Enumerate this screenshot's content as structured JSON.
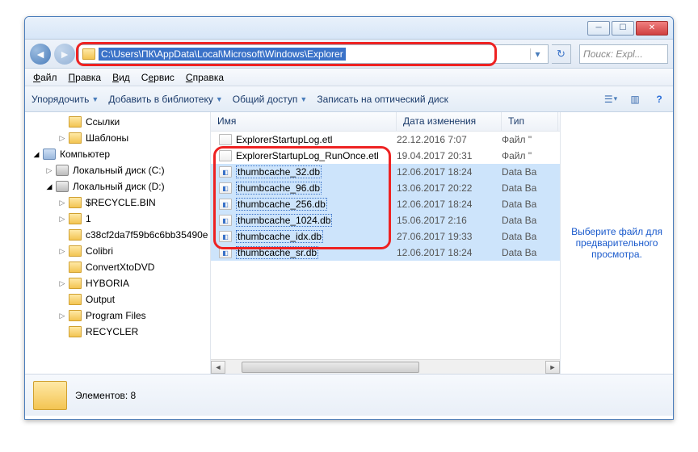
{
  "address_path": "C:\\Users\\ПК\\AppData\\Local\\Microsoft\\Windows\\Explorer",
  "search_placeholder": "Поиск: Expl...",
  "menu": {
    "file": "Файл",
    "edit": "Правка",
    "view": "Вид",
    "tools": "Сервис",
    "help": "Справка"
  },
  "toolbar": {
    "organize": "Упорядочить",
    "library": "Добавить в библиотеку",
    "share": "Общий доступ",
    "burn": "Записать на оптический диск"
  },
  "tree": [
    {
      "depth": 2,
      "arrow": "",
      "icon": "folder",
      "label": "Ссылки"
    },
    {
      "depth": 2,
      "arrow": "▷",
      "icon": "folder",
      "label": "Шаблоны"
    },
    {
      "depth": 0,
      "arrow": "◢",
      "icon": "comp",
      "label": "Компьютер"
    },
    {
      "depth": 1,
      "arrow": "▷",
      "icon": "drive",
      "label": "Локальный диск (C:)"
    },
    {
      "depth": 1,
      "arrow": "◢",
      "icon": "drive",
      "label": "Локальный диск (D:)"
    },
    {
      "depth": 2,
      "arrow": "▷",
      "icon": "folder",
      "label": "$RECYCLE.BIN"
    },
    {
      "depth": 2,
      "arrow": "▷",
      "icon": "folder",
      "label": "1"
    },
    {
      "depth": 2,
      "arrow": "",
      "icon": "folder",
      "label": "c38cf2da7f59b6c6bb35490e"
    },
    {
      "depth": 2,
      "arrow": "▷",
      "icon": "folder",
      "label": "Colibri"
    },
    {
      "depth": 2,
      "arrow": "",
      "icon": "folder",
      "label": "ConvertXtoDVD"
    },
    {
      "depth": 2,
      "arrow": "▷",
      "icon": "folder",
      "label": "HYBORIA"
    },
    {
      "depth": 2,
      "arrow": "",
      "icon": "folder",
      "label": "Output"
    },
    {
      "depth": 2,
      "arrow": "▷",
      "icon": "folder",
      "label": "Program Files"
    },
    {
      "depth": 2,
      "arrow": "",
      "icon": "folder",
      "label": "RECYCLER"
    }
  ],
  "columns": {
    "name": "Имя",
    "date": "Дата изменения",
    "type": "Тип"
  },
  "files": [
    {
      "name": "ExplorerStartupLog.etl",
      "date": "22.12.2016 7:07",
      "type": "Файл \"",
      "sel": false
    },
    {
      "name": "ExplorerStartupLog_RunOnce.etl",
      "date": "19.04.2017 20:31",
      "type": "Файл \"",
      "sel": false
    },
    {
      "name": "thumbcache_32.db",
      "date": "12.06.2017 18:24",
      "type": "Data Ba",
      "sel": true
    },
    {
      "name": "thumbcache_96.db",
      "date": "13.06.2017 20:22",
      "type": "Data Ba",
      "sel": true
    },
    {
      "name": "thumbcache_256.db",
      "date": "12.06.2017 18:24",
      "type": "Data Ba",
      "sel": true
    },
    {
      "name": "thumbcache_1024.db",
      "date": "15.06.2017 2:16",
      "type": "Data Ba",
      "sel": true
    },
    {
      "name": "thumbcache_idx.db",
      "date": "27.06.2017 19:33",
      "type": "Data Ba",
      "sel": true
    },
    {
      "name": "thumbcache_sr.db",
      "date": "12.06.2017 18:24",
      "type": "Data Ba",
      "sel": true
    }
  ],
  "preview_text": "Выберите файл для предварительного просмотра.",
  "status_label": "Элементов:",
  "status_count": "8"
}
